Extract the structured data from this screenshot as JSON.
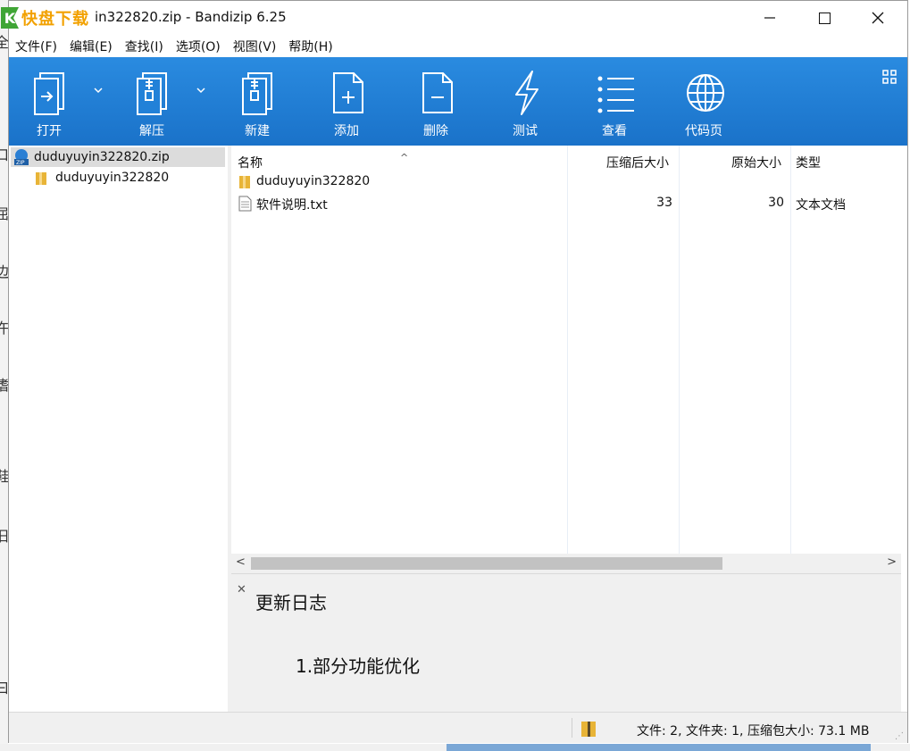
{
  "window": {
    "title": "in322820.zip - Bandizip 6.25",
    "logo_text": "快盘下载",
    "logo_letter": "K"
  },
  "background_chars": [
    "全",
    "口",
    "屈",
    "边",
    "仵",
    "嗜",
    "鞋",
    "旧",
    "曰"
  ],
  "menu": [
    "文件(F)",
    "编辑(E)",
    "查找(I)",
    "选项(O)",
    "视图(V)",
    "帮助(H)"
  ],
  "toolbar": {
    "open": "打开",
    "extract": "解压",
    "new": "新建",
    "add": "添加",
    "delete": "删除",
    "test": "测试",
    "view": "查看",
    "codepage": "代码页"
  },
  "tree": {
    "root": "duduyuyin322820.zip",
    "child": "duduyuyin322820"
  },
  "columns": {
    "name": "名称",
    "compressed": "压缩后大小",
    "original": "原始大小",
    "type": "类型"
  },
  "files": [
    {
      "name": "duduyuyin322820",
      "compressed": "",
      "original": "",
      "type": "",
      "kind": "folder"
    },
    {
      "name": "软件说明.txt",
      "compressed": "33",
      "original": "30",
      "type": "文本文档",
      "kind": "text"
    }
  ],
  "log": {
    "title": "更新日志",
    "body": "1.部分功能优化"
  },
  "status": {
    "text": "文件: 2, 文件夹: 1, 压缩包大小: 73.1 MB"
  },
  "colors": {
    "toolbar": "#1a72c9",
    "selection": "#dcdcdc",
    "folder": "#e8b437"
  }
}
